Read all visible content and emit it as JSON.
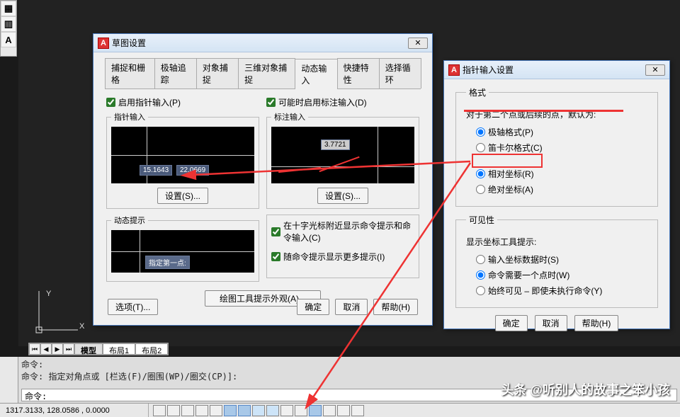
{
  "left_toolbar": {
    "icon1": "▦",
    "icon2": "▥",
    "icon3": "A"
  },
  "layout_tabs": {
    "model": "模型",
    "layout1": "布局1",
    "layout2": "布局2"
  },
  "command": {
    "line1": "命令:",
    "line2": "命令: 指定对角点或 [栏选(F)/圈围(WP)/圈交(CP)]:",
    "prompt": "命令:"
  },
  "status": {
    "coords": "1317.3133, 128.0586 , 0.0000"
  },
  "dialog_main": {
    "title": "草图设置",
    "tabs": {
      "snap_grid": "捕捉和栅格",
      "polar": "极轴追踪",
      "osnap": "对象捕捉",
      "osnap3d": "三维对象捕捉",
      "dyn_input": "动态输入",
      "quick_props": "快捷特性",
      "sel_cycle": "选择循环"
    },
    "enable_pointer": "启用指针输入(P)",
    "enable_dim": "可能时启用标注输入(D)",
    "grp_pointer": "指针输入",
    "grp_dim": "标注输入",
    "grp_dyn_prompt": "动态提示",
    "preview_pointer_v1": "15.1643",
    "preview_pointer_v2": "22.0669",
    "preview_dim_v": "3.7721",
    "preview_prompt_text": "指定第一点:",
    "btn_settings_s": "设置(S)...",
    "chk_cmd_prompt": "在十字光标附近显示命令提示和命令输入(C)",
    "chk_more_prompt": "随命令提示显示更多提示(I)",
    "btn_draft_appearance": "绘图工具提示外观(A)...",
    "btn_options": "选项(T)...",
    "btn_ok": "确定",
    "btn_cancel": "取消",
    "btn_help": "帮助(H)"
  },
  "dialog_pointer": {
    "title": "指针输入设置",
    "grp_format": "格式",
    "format_subtitle": "对于第二个点或后续的点，默认为:",
    "opt_polar": "极轴格式(P)",
    "opt_cartesian": "笛卡尔格式(C)",
    "opt_relative": "相对坐标(R)",
    "opt_absolute": "绝对坐标(A)",
    "grp_visibility": "可见性",
    "vis_subtitle": "显示坐标工具提示:",
    "opt_vis_input": "输入坐标数据时(S)",
    "opt_vis_cmd": "命令需要一个点时(W)",
    "opt_vis_always": "始终可见 – 即使未执行命令(Y)",
    "btn_ok": "确定",
    "btn_cancel": "取消",
    "btn_help": "帮助(H)"
  },
  "watermark": "头条 @听别人的故事之笨小孩"
}
